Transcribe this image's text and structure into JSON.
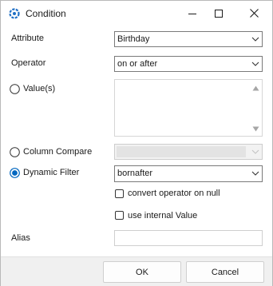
{
  "window": {
    "title": "Condition"
  },
  "form": {
    "attribute": {
      "label": "Attribute",
      "value": "Birthday"
    },
    "operator": {
      "label": "Operator",
      "value": "on or after"
    },
    "values": {
      "label": "Value(s)",
      "value": ""
    },
    "column_compare": {
      "label": "Column Compare",
      "value": ""
    },
    "dynamic_filter": {
      "label": "Dynamic Filter",
      "value": "bornafter"
    },
    "convert_operator_on_null": {
      "label": "convert operator on null",
      "checked": false
    },
    "use_internal_value": {
      "label": "use internal Value",
      "checked": false
    },
    "alias": {
      "label": "Alias",
      "value": ""
    },
    "selected_mode": "dynamic_filter"
  },
  "buttons": {
    "ok": "OK",
    "cancel": "Cancel"
  },
  "icons": {
    "app": "condition-ring-icon",
    "minimize": "minimize-icon",
    "maximize": "maximize-icon",
    "close": "close-icon",
    "dropdown": "chevron-down-icon",
    "scroll_up": "scroll-up-icon",
    "scroll_down": "scroll-down-icon"
  },
  "colors": {
    "accent": "#0067c0",
    "footer_bg": "#f0f0f0",
    "border": "#7a7a7a"
  }
}
